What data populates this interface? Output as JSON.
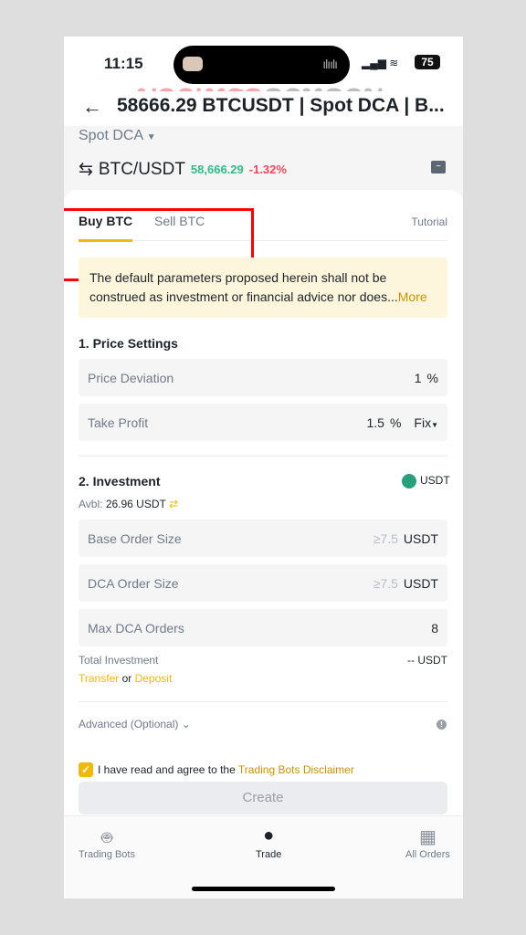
{
  "status_bar": {
    "time": "11:15",
    "battery": "75"
  },
  "watermark": {
    "text_red": "บอกเทรด",
    "text_gray": "ดอทคอม"
  },
  "header": {
    "title": "58666.29 BTCUSDT | Spot DCA | B..."
  },
  "strategy_selector": {
    "label": "Spot DCA"
  },
  "pair": {
    "symbol": "BTC/USDT",
    "price": "58,666.29",
    "change": "-1.32%"
  },
  "colors": {
    "accent": "#f0b90b",
    "up": "#2ebd85",
    "down": "#f6465d",
    "highlight_box": "#ff0000"
  },
  "tabs": [
    {
      "label": "Buy BTC",
      "active": true
    },
    {
      "label": "Sell BTC",
      "active": false
    }
  ],
  "tutorial_label": "Tutorial",
  "notice": {
    "text": "The default parameters proposed herein shall not be construed as investment or financial advice nor does...",
    "more": "More"
  },
  "price_settings": {
    "title": "1. Price Settings",
    "price_deviation": {
      "label": "Price Deviation",
      "value": "1",
      "unit": "%"
    },
    "take_profit": {
      "label": "Take Profit",
      "value": "1.5",
      "unit": "%",
      "mode": "Fix"
    }
  },
  "investment": {
    "title": "2. Investment",
    "currency": "USDT",
    "avbl_label": "Avbl:",
    "avbl_value": "26.96 USDT",
    "base_order": {
      "label": "Base Order Size",
      "placeholder": "≥7.5",
      "unit": "USDT"
    },
    "dca_order": {
      "label": "DCA Order Size",
      "placeholder": "≥7.5",
      "unit": "USDT"
    },
    "max_dca": {
      "label": "Max DCA Orders",
      "value": "8"
    },
    "total_label": "Total Investment",
    "total_value": "-- USDT",
    "transfer": "Transfer",
    "or": "or",
    "deposit": "Deposit"
  },
  "advanced_label": "Advanced (Optional)",
  "agree": {
    "checked": true,
    "text": "I have read and agree to the ",
    "link": "Trading Bots Disclaimer"
  },
  "create_label": "Create",
  "bottom_nav": [
    {
      "label": "Trading Bots",
      "icon": "robot-icon"
    },
    {
      "label": "Trade",
      "icon": "trade-icon",
      "active": true
    },
    {
      "label": "All Orders",
      "icon": "orders-icon"
    }
  ]
}
